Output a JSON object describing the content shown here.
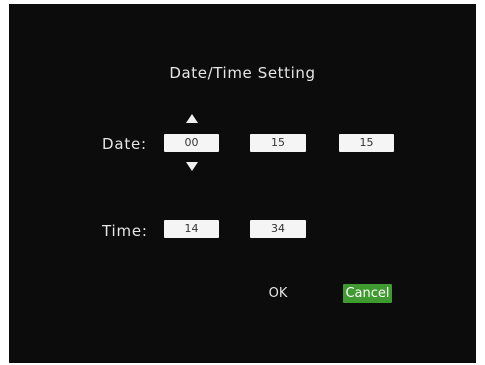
{
  "dialog": {
    "title": "Date/Time Setting"
  },
  "date": {
    "label": "Date:",
    "fields": [
      "00",
      "15",
      "15"
    ]
  },
  "time": {
    "label": "Time:",
    "fields": [
      "14",
      "34"
    ]
  },
  "buttons": {
    "ok_label": "OK",
    "cancel_label": "Cancel"
  },
  "colors": {
    "background": "#0c0c0c",
    "field": "#f5f5f5",
    "cancel_accent": "#3f9a30",
    "text": "#e6e6e6"
  },
  "icons": {
    "increment": "up-arrow-icon",
    "decrement": "down-arrow-icon"
  }
}
